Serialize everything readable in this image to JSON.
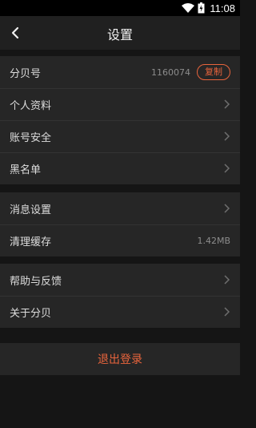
{
  "status_bar": {
    "time": "11:08",
    "battery_label": ""
  },
  "header": {
    "title": "设置"
  },
  "account": {
    "id_label": "分贝号",
    "id_value": "1160074",
    "copy_label": "复制",
    "items": [
      "个人资料",
      "账号安全",
      "黑名单"
    ]
  },
  "settings": {
    "message_label": "消息设置",
    "cache_label": "清理缓存",
    "cache_value": "1.42MB"
  },
  "about": {
    "help_label": "帮助与反馈",
    "about_label": "关于分贝"
  },
  "logout_label": "退出登录",
  "colors": {
    "accent": "#e8643c",
    "background": "#151515",
    "row": "#262626"
  }
}
